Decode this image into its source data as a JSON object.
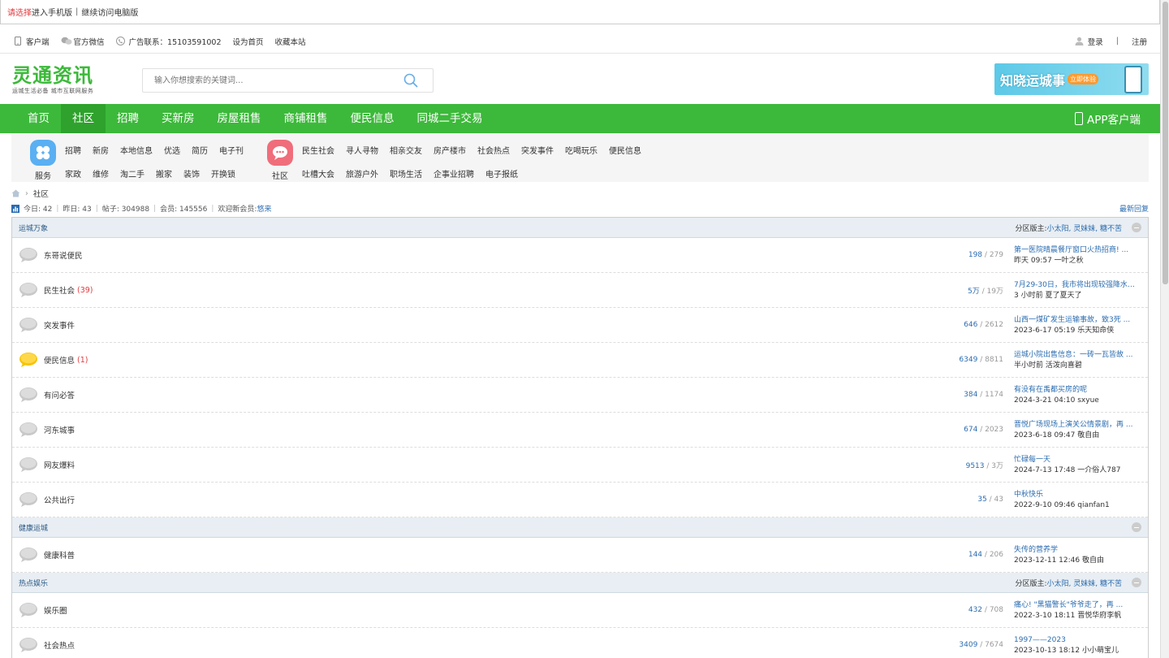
{
  "mobile_bar": {
    "choose": "请选择",
    "mobile": "进入手机版",
    "sep": "|",
    "desktop": "继续访问电脑版"
  },
  "topbar": {
    "client": "客户端",
    "wechat": "官方微信",
    "ad": "广告联系：15103591002",
    "set_home": "设为首页",
    "favorite": "收藏本站",
    "login": "登录",
    "divider": "|",
    "register": "注册"
  },
  "header": {
    "logo_title": "灵通资讯",
    "logo_slogan": "运城生活必备  城市互联网服务",
    "search_placeholder": "输入你想搜索的关键词...",
    "banner_title": "知晓运城事",
    "banner_button": "立即体验"
  },
  "nav": {
    "items": [
      "首页",
      "社区",
      "招聘",
      "买新房",
      "房屋租售",
      "商铺租售",
      "便民信息",
      "同城二手交易"
    ],
    "active_index": 1,
    "app_label": "APP客户端"
  },
  "subnav": {
    "service": {
      "label": "服务",
      "row1": [
        "招聘",
        "新房",
        "本地信息",
        "优选",
        "简历",
        "电子刊"
      ],
      "row2": [
        "家政",
        "维修",
        "淘二手",
        "搬家",
        "装饰",
        "开换锁"
      ]
    },
    "community": {
      "label": "社区",
      "row1": [
        "民生社会",
        "寻人寻物",
        "相亲交友",
        "房产楼市",
        "社会热点",
        "突发事件",
        "吃喝玩乐",
        "便民信息"
      ],
      "row2": [
        "吐槽大会",
        "旅游户外",
        "职场生活",
        "企事业招聘",
        "电子报纸"
      ]
    }
  },
  "breadcrumb": {
    "arrow": "›",
    "current": "社区"
  },
  "stats": {
    "today": "今日: 42",
    "yesterday": "昨日: 43",
    "posts": "帖子: 304988",
    "members": "会员: 145556",
    "welcome": "欢迎新会员: ",
    "new_member": "悠来",
    "latest_reply": "最新回复",
    "pipe": "|"
  },
  "sections": [
    {
      "name": "运城万象",
      "mods_label": "分区版主: ",
      "mods": "小太阳, 灵妹妹, 糖不苦",
      "forums": [
        {
          "name": "东哥说便民",
          "today": "",
          "threads": "198",
          "posts": "279",
          "last_title": "第一医院晴晨餐厅窗口火热招商! ...",
          "last_meta": "昨天 09:57 一叶之秋",
          "hot": false
        },
        {
          "name": "民生社会",
          "today": "(39)",
          "threads": "5万",
          "posts": "19万",
          "last_title": "7月29-30日，我市将出现较强降水 ...",
          "last_meta": "3 小时前 夏了夏天了",
          "hot": false
        },
        {
          "name": "突发事件",
          "today": "",
          "threads": "646",
          "posts": "2612",
          "last_title": "山西一煤矿发生运输事故，致3死 ...",
          "last_meta": "2023-6-17 05:19 乐天知命侠",
          "hot": false
        },
        {
          "name": "便民信息",
          "today": "(1)",
          "threads": "6349",
          "posts": "8811",
          "last_title": "运城小院出售信息：一砖一瓦皆故 ...",
          "last_meta": "半小时前 活泼向喜碧",
          "hot": true
        },
        {
          "name": "有问必答",
          "today": "",
          "threads": "384",
          "posts": "1174",
          "last_title": "有没有在禹都买房的呢",
          "last_meta": "2024-3-21 04:10 sxyue",
          "hot": false
        },
        {
          "name": "河东城事",
          "today": "",
          "threads": "674",
          "posts": "2023",
          "last_title": "晋悦广场现场上演关公情景剧，再 ...",
          "last_meta": "2023-6-18 09:47 敬自由",
          "hot": false
        },
        {
          "name": "网友爆料",
          "today": "",
          "threads": "9513",
          "posts": "3万",
          "last_title": "忙碌每一天",
          "last_meta": "2024-7-13 17:48 一介俗人787",
          "hot": false
        },
        {
          "name": "公共出行",
          "today": "",
          "threads": "35",
          "posts": "43",
          "last_title": "中秋快乐",
          "last_meta": "2022-9-10 09:46 qianfan1",
          "hot": false
        }
      ]
    },
    {
      "name": "健康运城",
      "mods_label": "",
      "mods": "",
      "forums": [
        {
          "name": "健康科普",
          "today": "",
          "threads": "144",
          "posts": "206",
          "last_title": "失传的营养学",
          "last_meta": "2023-12-11 12:46 敬自由",
          "hot": false
        }
      ]
    },
    {
      "name": "热点娱乐",
      "mods_label": "分区版主: ",
      "mods": "小太阳, 灵妹妹, 糖不苦",
      "forums": [
        {
          "name": "娱乐圈",
          "today": "",
          "threads": "432",
          "posts": "708",
          "last_title": "痛心! \"黑猫警长\"爷爷走了，再 ...",
          "last_meta": "2022-3-10 18:11 晋悦华府李帆",
          "hot": false
        },
        {
          "name": "社会热点",
          "today": "",
          "threads": "3409",
          "posts": "7674",
          "last_title": "1997——2023",
          "last_meta": "2023-10-13 18:12 小小萌宝儿",
          "hot": false
        }
      ]
    }
  ],
  "colors": {
    "brand_green": "#3cb93a",
    "link_blue": "#2b6cb0",
    "today_red": "#e4393c"
  }
}
